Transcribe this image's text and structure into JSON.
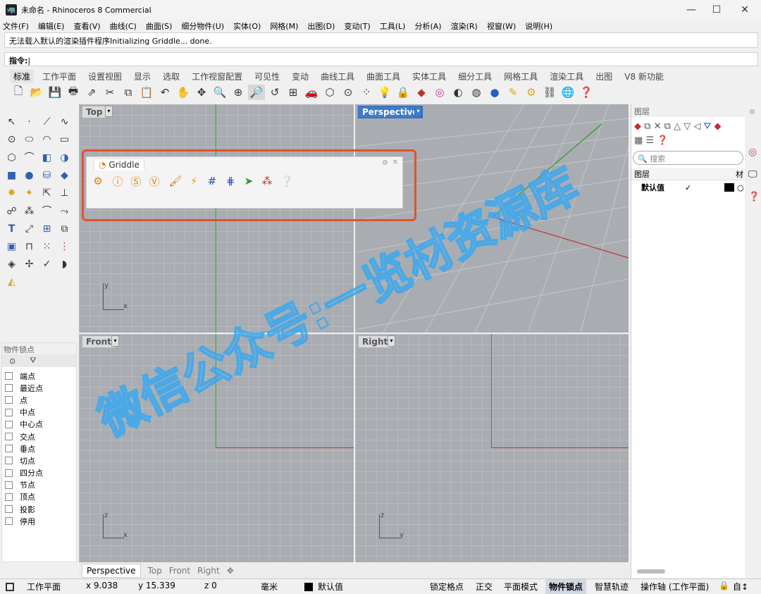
{
  "window": {
    "title": "未命名 - Rhinoceros 8 Commercial",
    "minimize": "—",
    "maximize": "☐",
    "close": "✕"
  },
  "menu": [
    "文件(F)",
    "编辑(E)",
    "查看(V)",
    "曲线(C)",
    "曲面(S)",
    "细分物件(U)",
    "实体(O)",
    "网格(M)",
    "出图(D)",
    "变动(T)",
    "工具(L)",
    "分析(A)",
    "渲染(R)",
    "视窗(W)",
    "说明(H)"
  ],
  "command_history": "无法载入默认的渲染插件程序Initializing Griddle... done.",
  "command_prompt": "指令:",
  "toolbar_tabs": [
    "标准",
    "工作平面",
    "设置视图",
    "显示",
    "选取",
    "工作视窗配置",
    "可见性",
    "变动",
    "曲线工具",
    "曲面工具",
    "实体工具",
    "细分工具",
    "网格工具",
    "渲染工具",
    "出图",
    "V8 新功能"
  ],
  "viewports": {
    "top": "Top",
    "perspective": "Perspective",
    "front": "Front",
    "right": "Right"
  },
  "viewport_tabs": [
    "Perspective",
    "Top",
    "Front",
    "Right",
    "✥"
  ],
  "griddle_panel": {
    "title": "Griddle"
  },
  "osnap_panel": {
    "title": "物件锁点",
    "items": [
      "端点",
      "最近点",
      "点",
      "中点",
      "中心点",
      "交点",
      "垂点",
      "切点",
      "四分点",
      "节点",
      "顶点",
      "投影",
      "停用"
    ]
  },
  "layers_panel": {
    "title": "图层",
    "search_placeholder": "搜索",
    "col_layer": "图层",
    "col_material": "材",
    "layer_name": "默认值",
    "check": "✓"
  },
  "status_bar": {
    "cplane": "工作平面",
    "x": "x 9.038",
    "y": "y 15.339",
    "z": "z 0",
    "unit": "毫米",
    "layer": "默认值",
    "grid_snap": "锁定格点",
    "ortho": "正交",
    "planar": "平面模式",
    "osnap": "物件锁点",
    "smarttrack": "智慧轨迹",
    "gumball": "操作轴 (工作平面)",
    "auto": "自↕"
  },
  "watermark": "微信公众号:一览材资源库",
  "colors": {
    "accent": "#3d7ccc",
    "highlight": "#e0522c",
    "x_axis": "#c03030",
    "y_axis": "#2d9b2d"
  }
}
